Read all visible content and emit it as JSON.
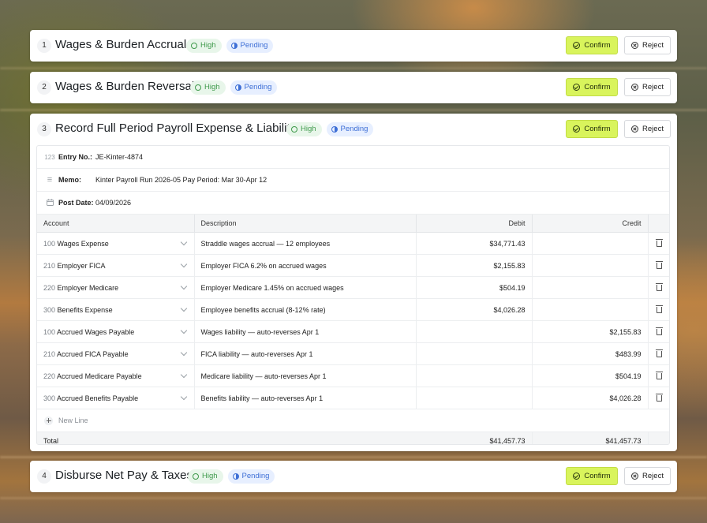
{
  "entries": [
    {
      "num": "1",
      "title": "Wages & Burden Accrual",
      "confidence": "High",
      "status": "Pending",
      "confirm": "Confirm",
      "reject": "Reject"
    },
    {
      "num": "2",
      "title": "Wages & Burden Reversal",
      "confidence": "High",
      "status": "Pending",
      "confirm": "Confirm",
      "reject": "Reject"
    },
    {
      "num": "3",
      "title": "Record Full Period Payroll Expense & Liability",
      "confidence": "High",
      "status": "Pending",
      "confirm": "Confirm",
      "reject": "Reject"
    },
    {
      "num": "4",
      "title": "Disburse Net Pay & Taxes",
      "confidence": "High",
      "status": "Pending",
      "confirm": "Confirm",
      "reject": "Reject"
    }
  ],
  "detail": {
    "entry_no_label": "Entry No.:",
    "entry_no": "JE-Kinter-4874",
    "memo_label": "Memo:",
    "memo": "Kinter Payroll Run 2026-05 Pay Period: Mar 30-Apr 12",
    "post_date_label": "Post Date:",
    "post_date": "04/09/2026",
    "icons": {
      "entry_no": "123",
      "memo": "≡",
      "post_date": "calendar"
    },
    "columns": {
      "account": "Account",
      "description": "Description",
      "debit": "Debit",
      "credit": "Credit"
    },
    "rows": [
      {
        "code": "100",
        "account": "Wages Expense",
        "description": "Straddle wages accrual — 12 employees",
        "debit": "$34,771.43",
        "credit": ""
      },
      {
        "code": "210",
        "account": "Employer FICA",
        "description": "Employer FICA 6.2% on accrued wages",
        "debit": "$2,155.83",
        "credit": ""
      },
      {
        "code": "220",
        "account": "Employer Medicare",
        "description": "Employer Medicare 1.45% on accrued wages",
        "debit": "$504.19",
        "credit": ""
      },
      {
        "code": "300",
        "account": "Benefits Expense",
        "description": "Employee benefits accrual (8-12% rate)",
        "debit": "$4,026.28",
        "credit": ""
      },
      {
        "code": "100",
        "account": "Accrued Wages Payable",
        "description": "Wages liability — auto-reverses Apr 1",
        "debit": "",
        "credit": "$2,155.83"
      },
      {
        "code": "210",
        "account": "Accrued FICA Payable",
        "description": "FICA liability — auto-reverses Apr 1",
        "debit": "",
        "credit": "$483.99"
      },
      {
        "code": "220",
        "account": "Accrued Medicare Payable",
        "description": "Medicare liability — auto-reverses Apr 1",
        "debit": "",
        "credit": "$504.19"
      },
      {
        "code": "300",
        "account": "Accrued Benefits Payable",
        "description": "Benefits liability — auto-reverses Apr 1",
        "debit": "",
        "credit": "$4,026.28"
      }
    ],
    "new_line": "New Line",
    "total_label": "Total",
    "total_debit": "$41,457.73",
    "total_credit": "$41,457.73"
  }
}
